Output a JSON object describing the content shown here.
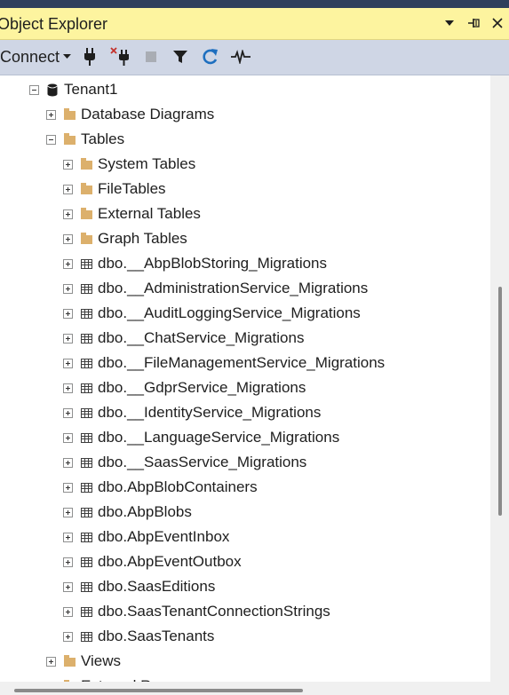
{
  "panel": {
    "title": "Object Explorer",
    "dropdown_icon": "chevron-down-icon",
    "pin_icon": "pin-icon",
    "close_icon": "close-icon"
  },
  "toolbar": {
    "connect_label": "Connect",
    "items": [
      "connect-dropdown",
      "connect-plug-icon",
      "disconnect-icon",
      "stop-icon",
      "filter-icon",
      "refresh-icon",
      "activity-monitor-icon"
    ]
  },
  "tree": {
    "nodes": [
      {
        "label": "Tenant1",
        "level": 0,
        "state": "expanded",
        "icon": "database-icon"
      },
      {
        "label": "Database Diagrams",
        "level": 1,
        "state": "collapsed",
        "icon": "folder-icon"
      },
      {
        "label": "Tables",
        "level": 1,
        "state": "expanded",
        "icon": "folder-icon"
      },
      {
        "label": "System Tables",
        "level": 2,
        "state": "collapsed",
        "icon": "folder-icon"
      },
      {
        "label": "FileTables",
        "level": 2,
        "state": "collapsed",
        "icon": "folder-icon"
      },
      {
        "label": "External Tables",
        "level": 2,
        "state": "collapsed",
        "icon": "folder-icon"
      },
      {
        "label": "Graph Tables",
        "level": 2,
        "state": "collapsed",
        "icon": "folder-icon"
      },
      {
        "label": "dbo.__AbpBlobStoring_Migrations",
        "level": 2,
        "state": "collapsed",
        "icon": "table-icon"
      },
      {
        "label": "dbo.__AdministrationService_Migrations",
        "level": 2,
        "state": "collapsed",
        "icon": "table-icon"
      },
      {
        "label": "dbo.__AuditLoggingService_Migrations",
        "level": 2,
        "state": "collapsed",
        "icon": "table-icon"
      },
      {
        "label": "dbo.__ChatService_Migrations",
        "level": 2,
        "state": "collapsed",
        "icon": "table-icon"
      },
      {
        "label": "dbo.__FileManagementService_Migrations",
        "level": 2,
        "state": "collapsed",
        "icon": "table-icon"
      },
      {
        "label": "dbo.__GdprService_Migrations",
        "level": 2,
        "state": "collapsed",
        "icon": "table-icon"
      },
      {
        "label": "dbo.__IdentityService_Migrations",
        "level": 2,
        "state": "collapsed",
        "icon": "table-icon"
      },
      {
        "label": "dbo.__LanguageService_Migrations",
        "level": 2,
        "state": "collapsed",
        "icon": "table-icon"
      },
      {
        "label": "dbo.__SaasService_Migrations",
        "level": 2,
        "state": "collapsed",
        "icon": "table-icon"
      },
      {
        "label": "dbo.AbpBlobContainers",
        "level": 2,
        "state": "collapsed",
        "icon": "table-icon"
      },
      {
        "label": "dbo.AbpBlobs",
        "level": 2,
        "state": "collapsed",
        "icon": "table-icon"
      },
      {
        "label": "dbo.AbpEventInbox",
        "level": 2,
        "state": "collapsed",
        "icon": "table-icon"
      },
      {
        "label": "dbo.AbpEventOutbox",
        "level": 2,
        "state": "collapsed",
        "icon": "table-icon"
      },
      {
        "label": "dbo.SaasEditions",
        "level": 2,
        "state": "collapsed",
        "icon": "table-icon"
      },
      {
        "label": "dbo.SaasTenantConnectionStrings",
        "level": 2,
        "state": "collapsed",
        "icon": "table-icon"
      },
      {
        "label": "dbo.SaasTenants",
        "level": 2,
        "state": "collapsed",
        "icon": "table-icon"
      },
      {
        "label": "Views",
        "level": 1,
        "state": "collapsed",
        "icon": "folder-icon"
      },
      {
        "label": "External Resources",
        "level": 1,
        "state": "collapsed",
        "icon": "folder-icon"
      }
    ]
  },
  "colors": {
    "title_bg": "#fdf49f",
    "toolbar_bg": "#cfd6e5",
    "folder": "#dcb06c",
    "refresh_blue": "#1e6fbf",
    "disconnect_red": "#c4312b"
  }
}
